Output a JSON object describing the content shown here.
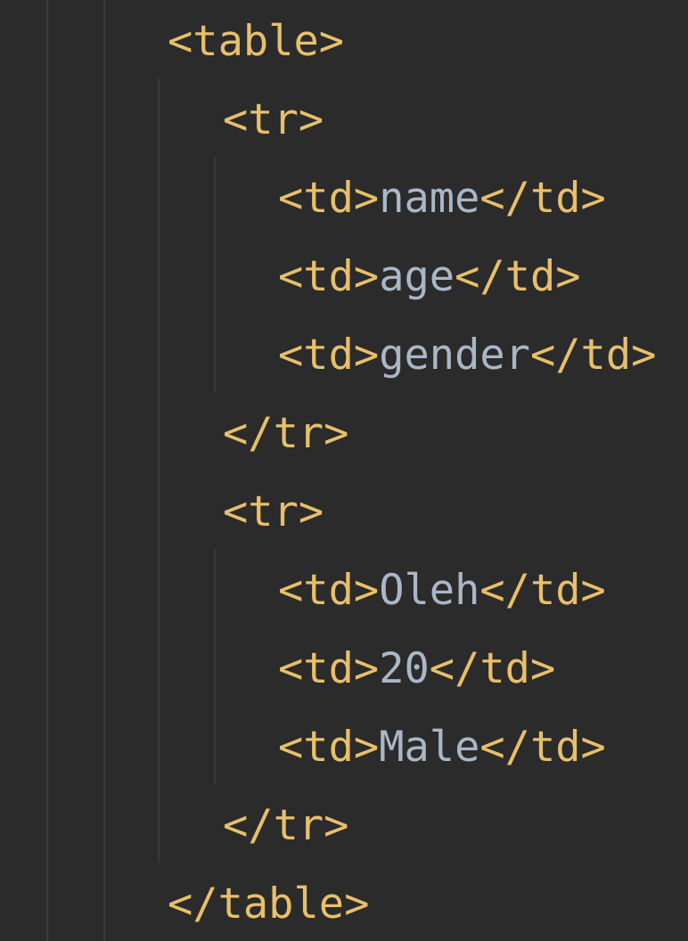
{
  "editor": {
    "language": "html",
    "colors": {
      "background": "#2b2b2b",
      "tag": "#e8bf6a",
      "text": "#a9b7c6",
      "indent_guide": "#3a3a3a"
    },
    "lines": [
      {
        "tag": "<table>"
      },
      {
        "tag": "<tr>"
      },
      {
        "open": "<td>",
        "text": "name",
        "close": "</td>"
      },
      {
        "open": "<td>",
        "text": "age",
        "close": "</td>"
      },
      {
        "open": "<td>",
        "text": "gender",
        "close": "</td>"
      },
      {
        "tag": "</tr>"
      },
      {
        "tag": "<tr>"
      },
      {
        "open": "<td>",
        "text": "Oleh",
        "close": "</td>"
      },
      {
        "open": "<td>",
        "text": "20",
        "close": "</td>"
      },
      {
        "open": "<td>",
        "text": "Male",
        "close": "</td>"
      },
      {
        "tag": "</tr>"
      },
      {
        "tag": "</table>"
      }
    ]
  }
}
